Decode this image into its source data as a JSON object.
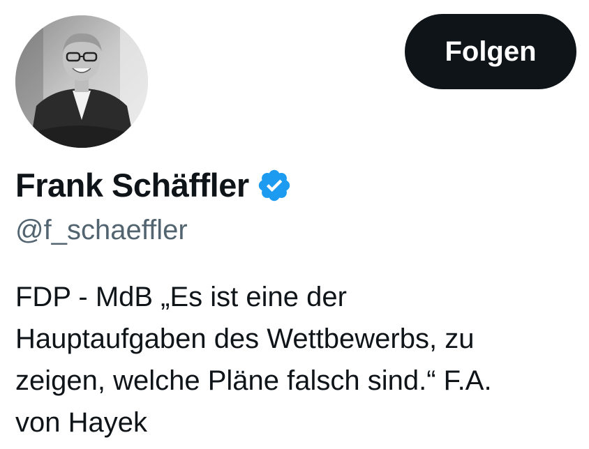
{
  "profile": {
    "avatar_alt": "Frank Schäffler profile photo",
    "display_name": "Frank Schäffler",
    "verified_icon": "verified-badge-icon",
    "handle": "@f_schaeffler",
    "bio_lines": [
      "FDP - MdB „Es ist eine der",
      "Hauptaufgaben des Wettbewerbs, zu",
      "zeigen, welche Pläne falsch sind.“ F.A.",
      "von Hayek"
    ]
  },
  "actions": {
    "follow_label": "Folgen"
  },
  "colors": {
    "text_primary": "#0f1419",
    "text_secondary": "#536471",
    "button_bg": "#0f1419",
    "button_text": "#ffffff",
    "verified_blue": "#1d9bf0"
  }
}
